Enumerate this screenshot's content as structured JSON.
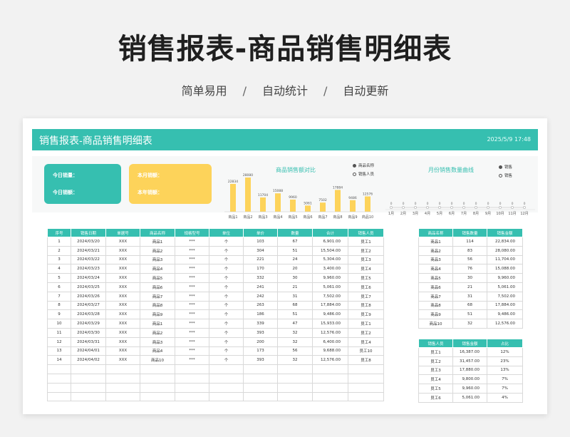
{
  "banner": {
    "title": "销售报表-商品销售明细表",
    "tags": [
      "简单易用",
      "自动统计",
      "自动更新"
    ],
    "separator": "/"
  },
  "sheet": {
    "title": "销售报表-商品销售明细表",
    "date": "2025/5/9 17:48"
  },
  "cards": {
    "today_sales_qty": "今日销量：",
    "today_sales_amount": "今日销额：",
    "month_sales_amount": "本月销额：",
    "year_sales_amount": "本年销额："
  },
  "colors": {
    "accent": "#36bfb0",
    "yellow": "#fdd35a"
  },
  "chart_data": [
    {
      "type": "bar",
      "title": "商品销售额对比",
      "categories": [
        "商品1",
        "商品2",
        "商品3",
        "商品4",
        "商品5",
        "商品6",
        "商品7",
        "商品8",
        "商品9",
        "商品10"
      ],
      "values": [
        22834,
        28080,
        11704,
        15088,
        9960,
        5061,
        7502,
        17884,
        9486,
        12576
      ],
      "labels": [
        "22834",
        "28080",
        "11704",
        "15088",
        "9960",
        "5061",
        "7502",
        "17884",
        "9486",
        "12576"
      ],
      "legend": [
        "商品名称",
        "销售人员"
      ],
      "legend_position": "top-right"
    },
    {
      "type": "line",
      "title": "月份销售数量曲线",
      "categories": [
        "1月",
        "2月",
        "3月",
        "4月",
        "5月",
        "6月",
        "7月",
        "8月",
        "9月",
        "10月",
        "11月",
        "12月"
      ],
      "values": [
        0,
        0,
        0,
        0,
        0,
        0,
        0,
        0,
        0,
        0,
        0,
        0
      ],
      "labels": [
        "0",
        "0",
        "0",
        "0",
        "0",
        "0",
        "0",
        "0",
        "0",
        "0",
        "0",
        "0"
      ],
      "legend": [
        "销售",
        "销售"
      ],
      "legend_position": "top-right"
    }
  ],
  "main_table": {
    "headers": [
      "序号",
      "销售日期",
      "单据号",
      "商品名称",
      "规格型号",
      "单位",
      "单价",
      "数量",
      "合计",
      "销售人员"
    ],
    "rows": [
      [
        "1",
        "2024/03/20",
        "XXX",
        "商品1",
        "***",
        "个",
        "103",
        "67",
        "6,901.00",
        "员工1"
      ],
      [
        "2",
        "2024/03/21",
        "XXX",
        "商品2",
        "***",
        "个",
        "304",
        "51",
        "15,504.00",
        "员工2"
      ],
      [
        "3",
        "2024/03/22",
        "XXX",
        "商品3",
        "***",
        "个",
        "221",
        "24",
        "5,304.00",
        "员工3"
      ],
      [
        "4",
        "2024/03/23",
        "XXX",
        "商品4",
        "***",
        "个",
        "170",
        "20",
        "3,400.00",
        "员工4"
      ],
      [
        "5",
        "2024/03/24",
        "XXX",
        "商品5",
        "***",
        "个",
        "332",
        "30",
        "9,960.00",
        "员工5"
      ],
      [
        "6",
        "2024/03/25",
        "XXX",
        "商品6",
        "***",
        "个",
        "241",
        "21",
        "5,061.00",
        "员工6"
      ],
      [
        "7",
        "2024/03/26",
        "XXX",
        "商品7",
        "***",
        "个",
        "242",
        "31",
        "7,502.00",
        "员工7"
      ],
      [
        "8",
        "2024/03/27",
        "XXX",
        "商品8",
        "***",
        "个",
        "263",
        "68",
        "17,884.00",
        "员工8"
      ],
      [
        "9",
        "2024/03/28",
        "XXX",
        "商品9",
        "***",
        "个",
        "186",
        "51",
        "9,486.00",
        "员工9"
      ],
      [
        "10",
        "2024/03/29",
        "XXX",
        "商品1",
        "***",
        "个",
        "339",
        "47",
        "15,933.00",
        "员工1"
      ],
      [
        "11",
        "2024/03/30",
        "XXX",
        "商品2",
        "***",
        "个",
        "393",
        "32",
        "12,576.00",
        "员工2"
      ],
      [
        "12",
        "2024/03/31",
        "XXX",
        "商品3",
        "***",
        "个",
        "200",
        "32",
        "6,400.00",
        "员工4"
      ],
      [
        "13",
        "2024/04/01",
        "XXX",
        "商品4",
        "***",
        "个",
        "173",
        "56",
        "9,688.00",
        "员工10"
      ],
      [
        "14",
        "2024/04/02",
        "XXX",
        "商品10",
        "***",
        "个",
        "393",
        "32",
        "12,576.00",
        "员工8"
      ]
    ],
    "empty_rows": 4
  },
  "product_summary": {
    "headers": [
      "商品名称",
      "销售数量",
      "销售金额"
    ],
    "rows": [
      [
        "商品1",
        "114",
        "22,834.00"
      ],
      [
        "商品2",
        "83",
        "28,080.00"
      ],
      [
        "商品3",
        "56",
        "11,704.00"
      ],
      [
        "商品4",
        "76",
        "15,088.00"
      ],
      [
        "商品5",
        "30",
        "9,960.00"
      ],
      [
        "商品6",
        "21",
        "5,061.00"
      ],
      [
        "商品7",
        "31",
        "7,502.00"
      ],
      [
        "商品8",
        "68",
        "17,884.00"
      ],
      [
        "商品9",
        "51",
        "9,486.00"
      ],
      [
        "商品10",
        "32",
        "12,576.00"
      ]
    ]
  },
  "staff_summary": {
    "headers": [
      "销售人员",
      "销售金额",
      "占比"
    ],
    "rows": [
      [
        "员工1",
        "16,387.00",
        "12%"
      ],
      [
        "员工2",
        "31,457.00",
        "23%"
      ],
      [
        "员工3",
        "17,880.00",
        "13%"
      ],
      [
        "员工4",
        "9,800.00",
        "7%"
      ],
      [
        "员工5",
        "9,960.00",
        "7%"
      ],
      [
        "员工6",
        "5,061.00",
        "4%"
      ]
    ]
  }
}
